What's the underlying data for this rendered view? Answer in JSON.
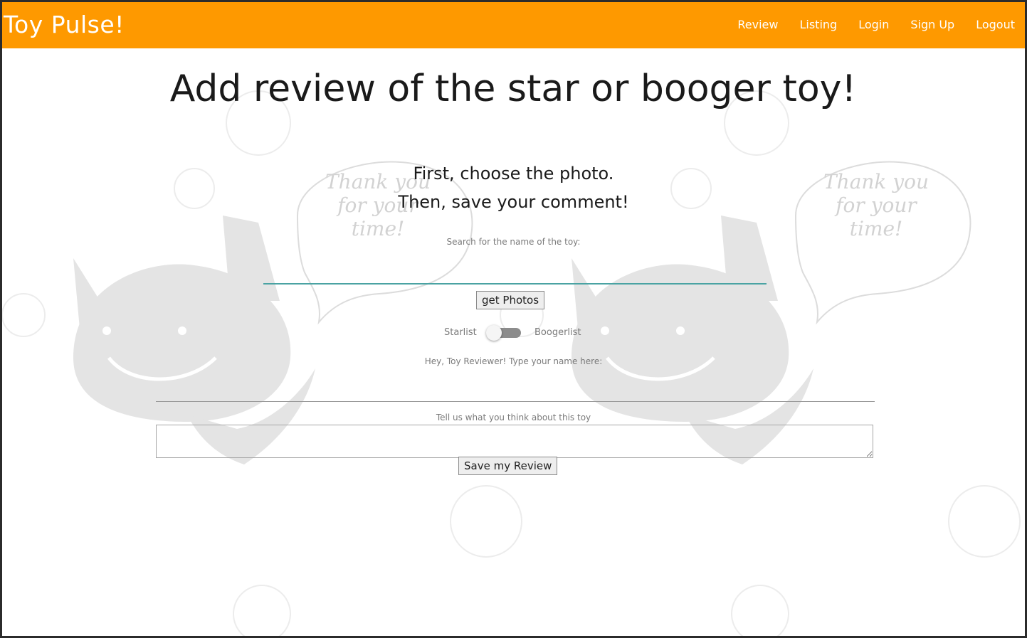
{
  "navbar": {
    "brand": "Toy Pulse!",
    "links": [
      "Review",
      "Listing",
      "Login",
      "Sign Up",
      "Logout"
    ],
    "color": "#fe9900"
  },
  "main": {
    "title": "Add review of the star or booger toy!",
    "subtitle_1": "First, choose the photo.",
    "subtitle_2": "Then, save your comment!",
    "search_label": "Search for the name of the toy:",
    "search_value": "",
    "get_photos_label": "get Photos",
    "toggle": {
      "left_label": "Starlist",
      "right_label": "Boogerlist",
      "state": "off"
    },
    "name_label": "Hey, Toy Reviewer! Type your name here:",
    "name_value": "",
    "comment_label": "Tell us what you think about this toy",
    "comment_value": "",
    "save_label": "Save my Review"
  },
  "background": {
    "bubble_text": [
      "Thank you",
      "for your",
      "time!"
    ],
    "icons": [
      "cat-mascot-icon",
      "speech-bubble-icon"
    ]
  }
}
